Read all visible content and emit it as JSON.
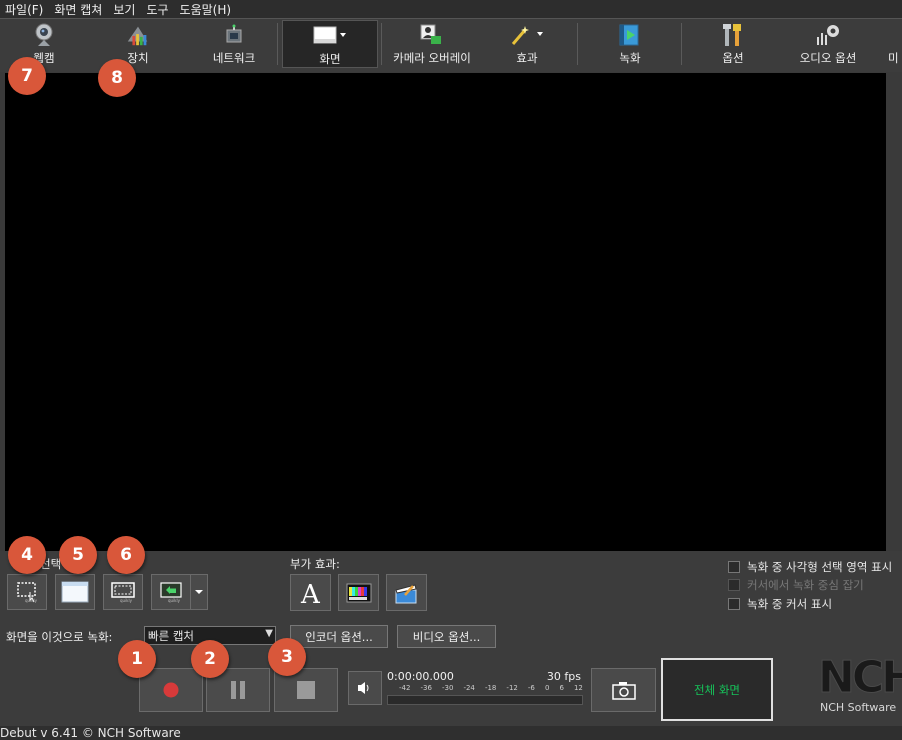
{
  "menu": [
    "파일(F)",
    "화면 캡쳐",
    "보기",
    "도구",
    "도움말(H)"
  ],
  "toolbar": [
    {
      "label": "웹캠",
      "icon": "webcam-icon"
    },
    {
      "label": "장치",
      "icon": "device-icon"
    },
    {
      "label": "네트워크",
      "icon": "network-icon"
    },
    {
      "label": "화면",
      "icon": "screen-icon",
      "active": true
    },
    {
      "label": "카메라 오버레이",
      "icon": "camera-overlay-icon"
    },
    {
      "label": "효과",
      "icon": "effects-wand-icon"
    },
    {
      "label": "녹화",
      "icon": "recordings-icon"
    },
    {
      "label": "옵션",
      "icon": "options-tools-icon"
    },
    {
      "label": "오디오 옵션",
      "icon": "audio-options-icon"
    },
    {
      "label": "미",
      "icon": "more-icon"
    }
  ],
  "capture": {
    "section_label": "선택",
    "effects_label": "부가 효과:",
    "record_to_label": "화면을 이것으로 녹화:",
    "record_to_value": "빠른 캡처",
    "encoder_button": "인코더 옵션...",
    "video_button": "비디오 옵션..."
  },
  "checkboxes": [
    {
      "label": "녹화 중 사각형 선택 영역 표시",
      "checked": false,
      "disabled": false
    },
    {
      "label": "커서에서 녹화 중심 잡기",
      "checked": false,
      "disabled": true
    },
    {
      "label": "녹화 중 커서 표시",
      "checked": false,
      "disabled": false
    }
  ],
  "meter": {
    "time": "0:00:00.000",
    "fps": "30 fps",
    "scale": [
      "-42",
      "-36",
      "-30",
      "-24",
      "-18",
      "-12",
      "-6",
      "0",
      "6",
      "12"
    ]
  },
  "fullscreen_label": "전체 화면",
  "logo": {
    "brand": "NCH",
    "sub": "NCH Software"
  },
  "status": "Debut v 6.41 © NCH Software",
  "markers": [
    "1",
    "2",
    "3",
    "4",
    "5",
    "6",
    "7",
    "8"
  ]
}
